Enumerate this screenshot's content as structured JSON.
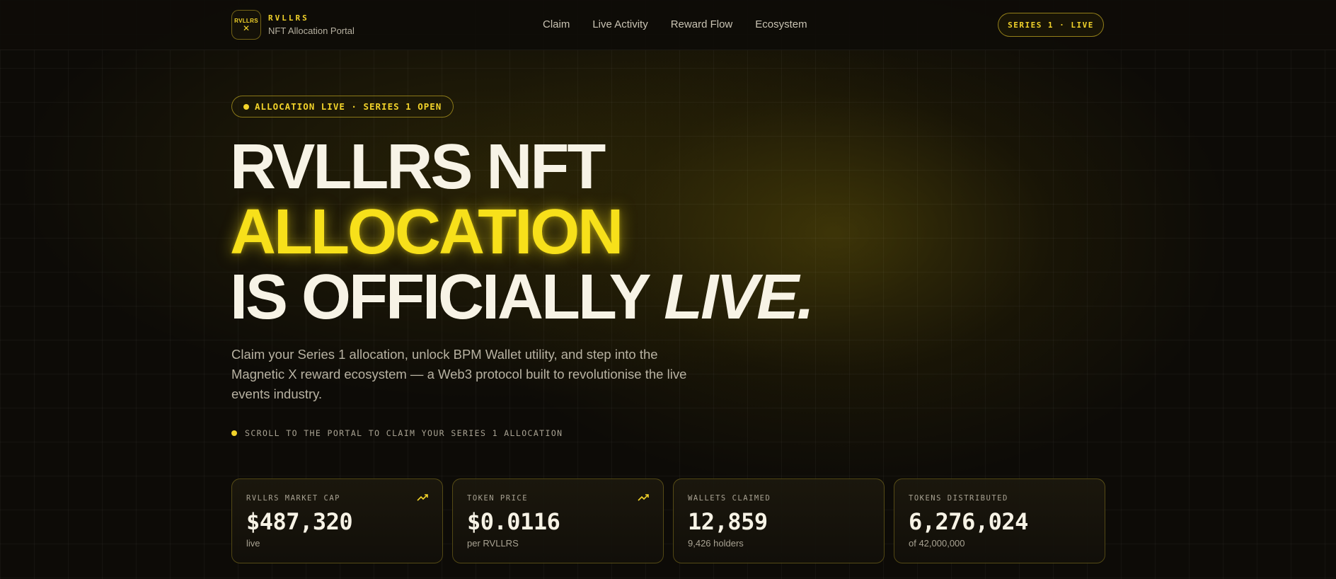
{
  "header": {
    "logo_line1": "RVLLRS",
    "logo_line2": "✕",
    "brand_name": "RVLLRS",
    "brand_sub": "NFT Allocation Portal",
    "nav": [
      "Claim",
      "Live Activity",
      "Reward Flow",
      "Ecosystem"
    ],
    "status_pill": "SERIES 1 · LIVE"
  },
  "hero": {
    "badge": "ALLOCATION LIVE · SERIES 1 OPEN",
    "headline_line1": "RVLLRS NFT",
    "headline_line2": "ALLOCATION",
    "headline_line3_a": "IS OFFICIALLY ",
    "headline_line3_b": "LIVE.",
    "lede": "Claim your Series 1 allocation, unlock BPM Wallet utility, and step into the Magnetic X reward ecosystem — a Web3 protocol built to revolutionise the live events industry.",
    "scroll_note": "SCROLL TO THE PORTAL TO CLAIM YOUR SERIES 1 ALLOCATION"
  },
  "stats": [
    {
      "label": "RVLLRS MARKET CAP",
      "value": "$487,320",
      "sub": "live",
      "trend": "trending-up-icon"
    },
    {
      "label": "TOKEN PRICE",
      "value": "$0.0116",
      "sub": "per RVLLRS",
      "trend": "trending-up-icon"
    },
    {
      "label": "WALLETS CLAIMED",
      "value": "12,859",
      "sub": "9,426 holders"
    },
    {
      "label": "TOKENS DISTRIBUTED",
      "value": "6,276,024",
      "sub": "of 42,000,000"
    }
  ],
  "colors": {
    "accent": "#f2d32a",
    "background": "#0d0b07",
    "text": "#f7f3e6"
  }
}
